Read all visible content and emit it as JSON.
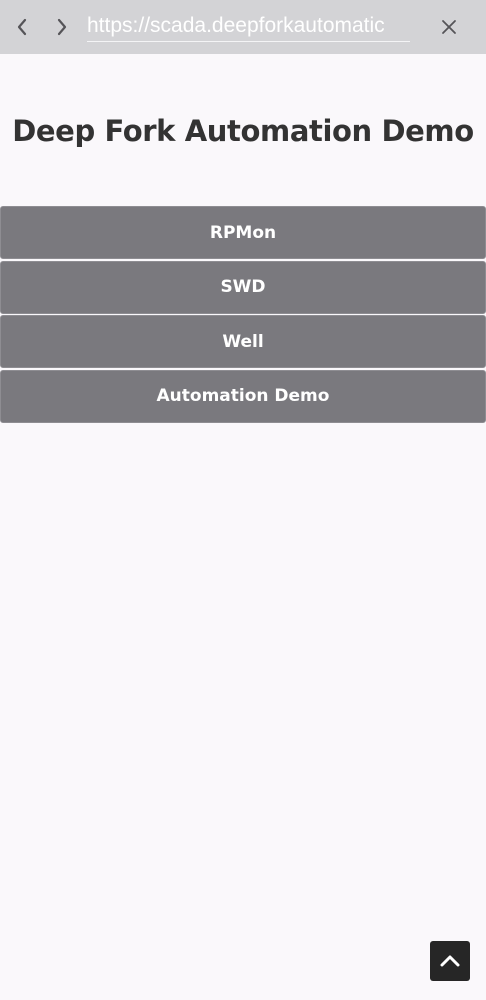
{
  "browser": {
    "url": "https://scada.deepforkautomatic",
    "icons": {
      "back": "chevron-left-icon",
      "forward": "chevron-right-icon",
      "close": "close-icon"
    }
  },
  "page": {
    "title": "Deep Fork Automation Demo"
  },
  "menu": {
    "items": [
      {
        "label": "RPMon"
      },
      {
        "label": "SWD"
      },
      {
        "label": "Well"
      },
      {
        "label": "Automation Demo"
      }
    ]
  },
  "scroll_top": {
    "icon": "chevron-up-icon"
  },
  "colors": {
    "toolbar_bg": "#d3d3d6",
    "page_bg": "#faf8fb",
    "button_bg": "#7a797e",
    "title_text": "#333333",
    "scroll_button_bg": "#262626"
  }
}
